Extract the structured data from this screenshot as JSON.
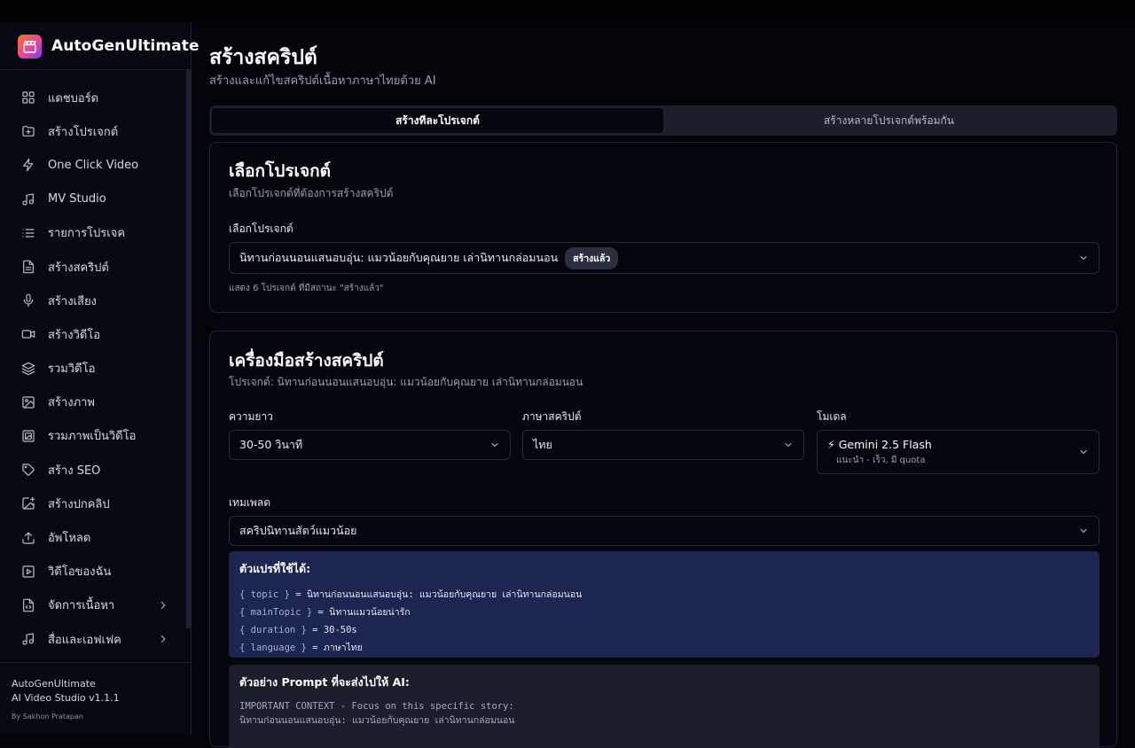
{
  "app": {
    "brand": "AutoGenUltimate",
    "footer_app": "AutoGenUltimate",
    "footer_version": "AI Video Studio v1.1.1",
    "footer_by": "By Sakhon Pratapan"
  },
  "sidebar": {
    "items": [
      {
        "label": "แดชบอร์ด",
        "icon": "dashboard-icon"
      },
      {
        "label": "สร้างโปรเจกต์",
        "icon": "folder-plus-icon"
      },
      {
        "label": "One Click Video",
        "icon": "lightning-icon"
      },
      {
        "label": "MV Studio",
        "icon": "music-icon"
      },
      {
        "label": "รายการโปรเจค",
        "icon": "list-icon"
      },
      {
        "label": "สร้างสคริปต์",
        "icon": "document-icon"
      },
      {
        "label": "สร้างเสียง",
        "icon": "microphone-icon"
      },
      {
        "label": "สร้างวิดีโอ",
        "icon": "video-icon"
      },
      {
        "label": "รวมวิดีโอ",
        "icon": "layers-icon"
      },
      {
        "label": "สร้างภาพ",
        "icon": "image-icon"
      },
      {
        "label": "รวมภาพเป็นวิดีโอ",
        "icon": "images-icon"
      },
      {
        "label": "สร้าง SEO",
        "icon": "tag-icon"
      },
      {
        "label": "สร้างปกคลิป",
        "icon": "image-plus-icon"
      },
      {
        "label": "อัพโหลด",
        "icon": "upload-icon"
      },
      {
        "label": "วิดีโอของฉัน",
        "icon": "play-square-icon"
      },
      {
        "label": "จัดการเนื้อหา",
        "icon": "code-file-icon"
      },
      {
        "label": "สื่อและเอฟเฟค",
        "icon": "music-note-icon"
      }
    ]
  },
  "header": {
    "title": "สร้างสคริปต์",
    "subtitle": "สร้างและแก้ไขสคริปต์เนื้อหาภาษาไทยด้วย AI"
  },
  "tabs": [
    {
      "label": "สร้างทีละโปรเจกต์",
      "active": true
    },
    {
      "label": "สร้างหลายโปรเจกต์พร้อมกัน",
      "active": false
    }
  ],
  "project_card": {
    "title": "เลือกโปรเจกต์",
    "subtitle": "เลือกโปรเจกต์ที่ต้องการสร้างสคริปต์",
    "field_label": "เลือกโปรเจกต์",
    "selected": "นิทานก่อนนอนแสนอบอุ่น: แมวน้อยกับคุณยาย เล่านิทานกล่อมนอน",
    "badge": "สร้างแล้ว",
    "hint": "แสดง 6 โปรเจกต์ ที่มีสถานะ \"สร้างแล้ว\""
  },
  "tool_card": {
    "title": "เครื่องมือสร้างสคริปต์",
    "subtitle": "โปรเจกต์: นิทานก่อนนอนแสนอบอุ่น: แมวน้อยกับคุณยาย เล่านิทานกล่อมนอน",
    "length_label": "ความยาว",
    "length_value": "30-50 วินาที",
    "lang_label": "ภาษาสคริปต์",
    "lang_value": "ไทย",
    "model_label": "โมเดล",
    "model_value": "⚡ Gemini 2.5 Flash",
    "model_note": "แนะนำ - เร็ว, มี quota",
    "template_label": "เทมเพลต",
    "template_value": "สคริปนิทานสัตว์แมวน้อย",
    "vars_title": "ตัวแปรที่ใช้ได้:",
    "vars": [
      {
        "key": "{ topic }",
        "value": " = นิทานก่อนนอนแสนอบอุ่น: แมวน้อยกับคุณยาย เล่านิทานกล่อมนอน"
      },
      {
        "key": "{ mainTopic }",
        "value": " = นิทานแมวน้อยน่ารัก"
      },
      {
        "key": "{ duration }",
        "value": " = 30-50s"
      },
      {
        "key": "{ language }",
        "value": " = ภาษาไทย"
      }
    ],
    "prompt_title": "ตัวอย่าง Prompt ที่จะส่งไปให้ AI:",
    "prompt_lines": [
      "IMPORTANT CONTEXT - Focus on this specific story:",
      "นิทานก่อนนอนแสนอบอุ่น: แมวน้อยกับคุณยาย เล่านิทานกล่อมนอน"
    ]
  }
}
